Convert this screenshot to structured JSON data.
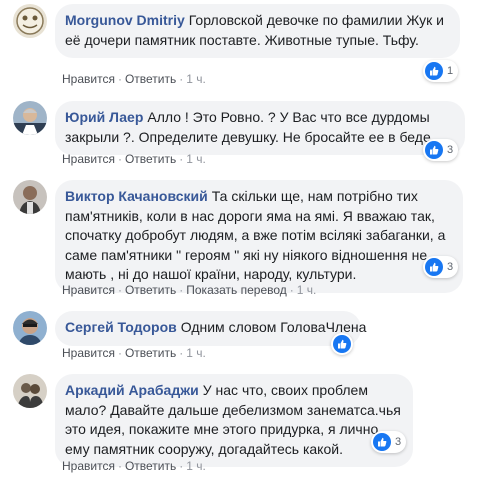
{
  "comments": [
    {
      "author": "Morgunov Dmitriy",
      "text": "Горловской девочке по фамилии Жук и её дочери памятник поставте. Животные тупые. Тьфу.",
      "like_label": "Нравится",
      "reply_label": "Ответить",
      "time": "1 ч.",
      "reaction_count": "1"
    },
    {
      "author": "Юрий Лаер",
      "text": "Алло ! Это Ровно. ? У Вас что все дурдомы закрыли ?. Определите девушку. Не бросайте ее в беде....",
      "like_label": "Нравится",
      "reply_label": "Ответить",
      "time": "1 ч.",
      "reaction_count": "3"
    },
    {
      "author": "Виктор Качановский",
      "text": "Та скільки ще, нам потрібно тих пам'ятників, коли в нас дороги яма на ямі. Я вважаю так, спочатку добробут людям, а вже потім всілякі забаганки, а саме пам'ятники \" героям \" які ну ніякого відношення не мають , ні до нашої країни, народу, культури.",
      "like_label": "Нравится",
      "reply_label": "Ответить",
      "translate_label": "Показать перевод",
      "time": "1 ч.",
      "reaction_count": "3"
    },
    {
      "author": "Сергей Тодоров",
      "text": "Одним словом ГоловаЧлена",
      "like_label": "Нравится",
      "reply_label": "Ответить",
      "time": "1 ч.",
      "reaction_count": ""
    },
    {
      "author": "Аркадий Арабаджи",
      "text": "У нас что, своих проблем мало? Давайте дальше дебелизмом занематса.чья это идея, покажите мне этого придурка, я лично ему памятник сооружу, догадайтесь какой.",
      "like_label": "Нравится",
      "reply_label": "Ответить",
      "time": "1 ч.",
      "reaction_count": "3"
    }
  ],
  "colors": {
    "author": "#385898",
    "bubble": "#f2f3f5",
    "like": "#1877f2",
    "meta": "#90949c"
  }
}
